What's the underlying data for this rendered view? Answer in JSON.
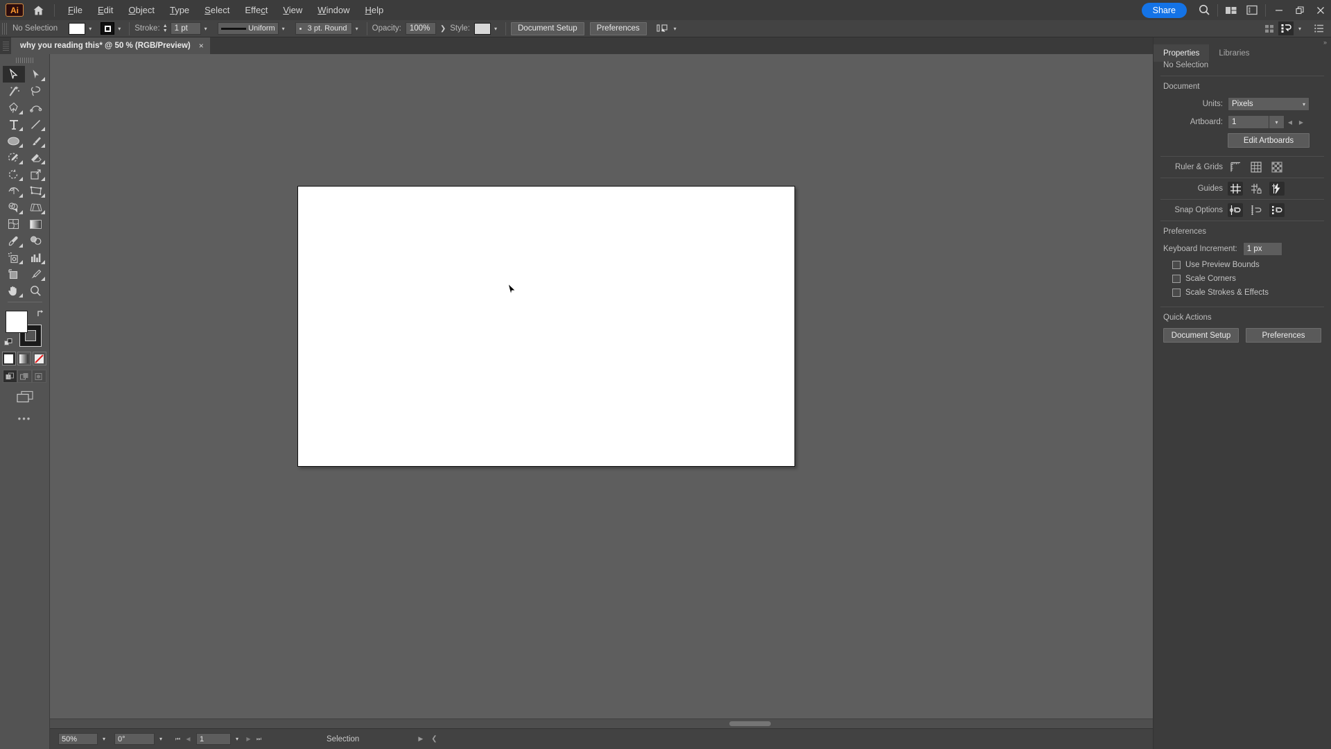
{
  "app": {
    "name": "Adobe Illustrator",
    "logo_text": "Ai",
    "logo_color": "#ff9a2e"
  },
  "menubar": {
    "home_icon": "home-icon",
    "items": [
      "File",
      "Edit",
      "Object",
      "Type",
      "Select",
      "Effect",
      "View",
      "Window",
      "Help"
    ],
    "share_label": "Share",
    "search_icon": "search-icon",
    "arrange_icon": "arrange-documents-icon",
    "workspace_icon": "workspace-switcher-icon",
    "window_minimize": "minimize-icon",
    "window_restore": "restore-icon",
    "window_close": "close-icon"
  },
  "controlbar": {
    "selection_status": "No Selection",
    "fill_swatch_color": "#ffffff",
    "stroke_label": "Stroke:",
    "stroke_weight": "1 pt",
    "stroke_profile": "Uniform",
    "brush_definition": "3 pt. Round",
    "opacity_label": "Opacity:",
    "opacity_value": "100%",
    "style_label": "Style:",
    "style_swatch_color": "#d8d8d8",
    "document_setup_label": "Document Setup",
    "preferences_label": "Preferences",
    "align_icon": "align-to-icon"
  },
  "tabbar": {
    "tabs": [
      {
        "title": "why you reading this* @ 50 % (RGB/Preview)",
        "close": "×",
        "active": true
      }
    ]
  },
  "toolbar": {
    "tools": [
      {
        "name": "selection-tool",
        "icon": "arrow-solid",
        "active": true,
        "flyout": false
      },
      {
        "name": "direct-selection-tool",
        "icon": "arrow-hollow",
        "active": false,
        "flyout": true
      },
      {
        "name": "magic-wand-tool",
        "icon": "magic-wand",
        "active": false,
        "flyout": false
      },
      {
        "name": "lasso-tool",
        "icon": "lasso",
        "active": false,
        "flyout": false
      },
      {
        "name": "pen-tool",
        "icon": "pen",
        "active": false,
        "flyout": true
      },
      {
        "name": "curvature-tool",
        "icon": "curvature",
        "active": false,
        "flyout": false
      },
      {
        "name": "type-tool",
        "icon": "type-T",
        "active": false,
        "flyout": true
      },
      {
        "name": "line-segment-tool",
        "icon": "line",
        "active": false,
        "flyout": true
      },
      {
        "name": "ellipse-tool",
        "icon": "ellipse",
        "active": false,
        "flyout": true
      },
      {
        "name": "paintbrush-tool",
        "icon": "paintbrush",
        "active": false,
        "flyout": true
      },
      {
        "name": "shaper-tool",
        "icon": "shaper-pencil",
        "active": false,
        "flyout": true
      },
      {
        "name": "eraser-tool",
        "icon": "eraser",
        "active": false,
        "flyout": true
      },
      {
        "name": "rotate-tool",
        "icon": "rotate",
        "active": false,
        "flyout": true
      },
      {
        "name": "scale-tool",
        "icon": "scale",
        "active": false,
        "flyout": true
      },
      {
        "name": "width-tool",
        "icon": "width",
        "active": false,
        "flyout": true
      },
      {
        "name": "free-transform-tool",
        "icon": "free-transform",
        "active": false,
        "flyout": true
      },
      {
        "name": "shape-builder-tool",
        "icon": "shape-builder",
        "active": false,
        "flyout": true
      },
      {
        "name": "perspective-grid-tool",
        "icon": "perspective-grid",
        "active": false,
        "flyout": true
      },
      {
        "name": "mesh-tool",
        "icon": "mesh",
        "active": false,
        "flyout": false
      },
      {
        "name": "gradient-tool",
        "icon": "gradient",
        "active": false,
        "flyout": false
      },
      {
        "name": "eyedropper-tool",
        "icon": "eyedropper",
        "active": false,
        "flyout": true
      },
      {
        "name": "blend-tool",
        "icon": "blend",
        "active": false,
        "flyout": false
      },
      {
        "name": "symbol-sprayer-tool",
        "icon": "symbol-sprayer",
        "active": false,
        "flyout": true
      },
      {
        "name": "column-graph-tool",
        "icon": "column-graph",
        "active": false,
        "flyout": true
      },
      {
        "name": "artboard-tool",
        "icon": "artboard",
        "active": false,
        "flyout": false
      },
      {
        "name": "slice-tool",
        "icon": "slice-knife",
        "active": false,
        "flyout": true
      },
      {
        "name": "hand-tool",
        "icon": "hand",
        "active": false,
        "flyout": true
      },
      {
        "name": "zoom-tool",
        "icon": "magnifier",
        "active": false,
        "flyout": false
      }
    ],
    "fill_color": "#ffffff",
    "stroke_color": "#1a1a1a",
    "swap_icon": "swap-fill-stroke-icon",
    "default_icon": "default-fill-stroke-icon",
    "paint_modes": [
      "color-swatch",
      "gradient-swatch",
      "none-swatch"
    ],
    "drawing_modes": [
      "draw-normal",
      "draw-behind",
      "draw-inside"
    ],
    "screen_mode_icon": "change-screen-mode-icon",
    "more_tools": "•••"
  },
  "canvas": {
    "zoom_label": "50%",
    "artboard_background": "#ffffff",
    "canvas_background": "#5e5e5e",
    "cursor": "selection-arrow-cursor"
  },
  "statusbar": {
    "zoom_value": "50%",
    "rotation_value": "0°",
    "artboard_number": "1",
    "status_text": "Selection",
    "first_icon": "first-artboard-icon",
    "prev_icon": "previous-artboard-icon",
    "next_icon": "next-artboard-icon",
    "last_icon": "last-artboard-icon"
  },
  "icondock": {
    "groups": [
      [
        "color-panel-icon",
        "color-guide-icon"
      ],
      [
        "swatches-panel-icon",
        "brushes-panel-icon",
        "symbols-panel-icon"
      ],
      [
        "align-panel-icon",
        "gradient-panel-icon",
        "transparency-panel-icon"
      ],
      [
        "appearance-panel-icon",
        "pathfinder-panel-icon"
      ],
      [
        "layers-panel-icon",
        "export-panel-icon",
        "artboards-panel-icon"
      ],
      [
        "comments-panel-icon"
      ]
    ]
  },
  "properties": {
    "tabs": [
      {
        "label": "Properties",
        "active": true
      },
      {
        "label": "Libraries",
        "active": false
      }
    ],
    "selection_status": "No Selection",
    "document_section": {
      "title": "Document",
      "units_label": "Units:",
      "units_value": "Pixels",
      "artboard_label": "Artboard:",
      "artboard_value": "1",
      "edit_artboards_label": "Edit Artboards",
      "prev_icon": "previous-artboard-icon",
      "next_icon": "next-artboard-icon"
    },
    "ruler_grids": {
      "label": "Ruler & Grids",
      "icons": [
        {
          "name": "show-rulers-icon",
          "on": false
        },
        {
          "name": "show-grid-icon",
          "on": false
        },
        {
          "name": "show-transparency-grid-icon",
          "on": false
        }
      ]
    },
    "guides": {
      "label": "Guides",
      "icons": [
        {
          "name": "show-guides-icon",
          "on": true
        },
        {
          "name": "lock-guides-icon",
          "on": false
        },
        {
          "name": "smart-guides-icon",
          "on": true
        }
      ]
    },
    "snap_options": {
      "label": "Snap Options",
      "icons": [
        {
          "name": "snap-to-point-icon",
          "on": true
        },
        {
          "name": "snap-to-grid-icon",
          "on": false
        },
        {
          "name": "snap-to-pixel-icon",
          "on": true
        }
      ]
    },
    "preferences": {
      "title": "Preferences",
      "keyboard_increment_label": "Keyboard Increment:",
      "keyboard_increment_value": "1 px",
      "checkboxes": [
        {
          "label": "Use Preview Bounds",
          "checked": false
        },
        {
          "label": "Scale Corners",
          "checked": false
        },
        {
          "label": "Scale Strokes & Effects",
          "checked": false
        }
      ]
    },
    "quick_actions": {
      "title": "Quick Actions",
      "buttons": [
        "Document Setup",
        "Preferences"
      ]
    }
  }
}
